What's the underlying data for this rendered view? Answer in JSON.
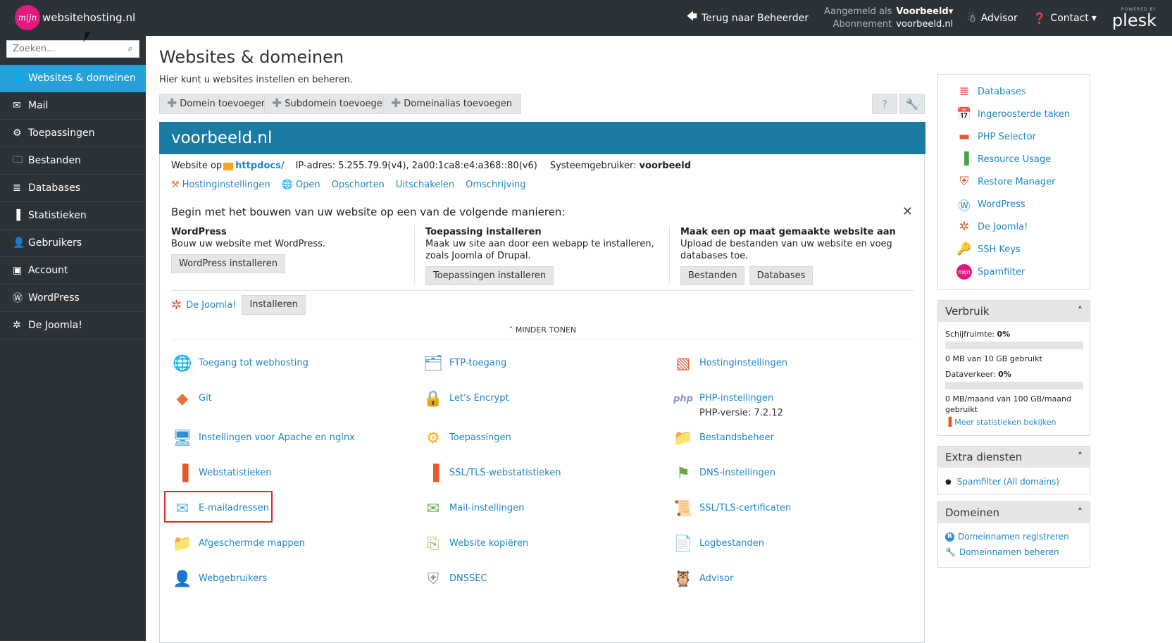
{
  "topbar": {
    "logo_mark": "mijn",
    "logo_text": "websitehosting.nl",
    "back_label": "Terug naar Beheerder",
    "logged_in_label": "Aangemeld als",
    "logged_in_user": "Voorbeeld",
    "subscription_label": "Abonnement",
    "subscription_value": "voorbeeld.nl",
    "advisor_label": "Advisor",
    "contact_label": "Contact",
    "powered_by": "POWERED BY",
    "plesk": "plesk"
  },
  "sidebar": {
    "search_placeholder": "Zoeken...",
    "items": [
      {
        "label": "Websites & domeinen",
        "icon": "globe-icon"
      },
      {
        "label": "Mail",
        "icon": "envelope-icon"
      },
      {
        "label": "Toepassingen",
        "icon": "gear-icon"
      },
      {
        "label": "Bestanden",
        "icon": "folder-icon"
      },
      {
        "label": "Databases",
        "icon": "database-icon"
      },
      {
        "label": "Statistieken",
        "icon": "bar-chart-icon"
      },
      {
        "label": "Gebruikers",
        "icon": "user-icon"
      },
      {
        "label": "Account",
        "icon": "account-icon"
      },
      {
        "label": "WordPress",
        "icon": "wordpress-icon"
      },
      {
        "label": "De Joomla!",
        "icon": "joomla-icon"
      }
    ]
  },
  "main": {
    "title": "Websites & domeinen",
    "subtitle": "Hier kunt u websites instellen en beheren.",
    "toolbar": {
      "add_domain": "Domein toevoegen",
      "add_subdomain": "Subdomein toevoegen",
      "add_alias": "Domeinalias toevoegen"
    },
    "domain": {
      "name": "voorbeeld.nl",
      "website_at_label": "Website op",
      "docroot": "httpdocs/",
      "ip_label": "IP-adres:",
      "ip_value": "5.255.79.9(v4), 2a00:1ca8:e4:a368::80(v6)",
      "sysuser_label": "Systeemgebruiker:",
      "sysuser_value": "voorbeeld",
      "links": {
        "hosting": "Hostinginstellingen",
        "open": "Open",
        "suspend": "Opschorten",
        "disable": "Uitschakelen",
        "description": "Omschrijving"
      }
    },
    "build": {
      "title": "Begin met het bouwen van uw website op een van de volgende manieren:",
      "cols": [
        {
          "title": "WordPress",
          "text": "Bouw uw website met WordPress.",
          "buttons": [
            "WordPress installeren"
          ]
        },
        {
          "title": "Toepassing installeren",
          "text": "Maak uw site aan door een webapp te installeren, zoals Joomla of Drupal.",
          "buttons": [
            "Toepassingen installeren"
          ]
        },
        {
          "title": "Maak een op maat gemaakte website aan",
          "text": "Upload de bestanden van uw website en voeg databases toe.",
          "buttons": [
            "Bestanden",
            "Databases"
          ]
        }
      ]
    },
    "joomla": {
      "label": "De Joomla!",
      "button": "Installeren"
    },
    "less_label": "MINDER TONEN",
    "tools": [
      {
        "label": "Toegang tot webhosting",
        "icon": "web-hosting-access-icon"
      },
      {
        "label": "FTP-toegang",
        "icon": "ftp-icon"
      },
      {
        "label": "Hostinginstellingen",
        "icon": "hosting-settings-icon"
      },
      {
        "label": "Git",
        "icon": "git-icon"
      },
      {
        "label": "Let's Encrypt",
        "icon": "lets-encrypt-icon"
      },
      {
        "label": "PHP-instellingen",
        "icon": "php-icon",
        "sub": "PHP-versie: 7.2.12"
      },
      {
        "label": "Instellingen voor Apache en nginx",
        "icon": "apache-nginx-icon"
      },
      {
        "label": "Toepassingen",
        "icon": "applications-icon"
      },
      {
        "label": "Bestandsbeheer",
        "icon": "file-manager-icon"
      },
      {
        "label": "Webstatistieken",
        "icon": "web-statistics-icon"
      },
      {
        "label": "SSL/TLS-webstatistieken",
        "icon": "ssl-statistics-icon"
      },
      {
        "label": "DNS-instellingen",
        "icon": "dns-icon"
      },
      {
        "label": "E-mailadressen",
        "icon": "email-icon"
      },
      {
        "label": "Mail-instellingen",
        "icon": "mail-settings-icon"
      },
      {
        "label": "SSL/TLS-certificaten",
        "icon": "certificate-icon"
      },
      {
        "label": "Afgeschermde mappen",
        "icon": "protected-folder-icon"
      },
      {
        "label": "Website kopiëren",
        "icon": "copy-website-icon"
      },
      {
        "label": "Logbestanden",
        "icon": "log-files-icon"
      },
      {
        "label": "Webgebruikers",
        "icon": "web-users-icon"
      },
      {
        "label": "DNSSEC",
        "icon": "dnssec-icon"
      },
      {
        "label": "Advisor",
        "icon": "advisor-owl-icon"
      }
    ]
  },
  "right": {
    "quick": [
      {
        "label": "Databases",
        "icon": "database-icon"
      },
      {
        "label": "Ingeroosterde taken",
        "icon": "calendar-icon"
      },
      {
        "label": "PHP Selector",
        "icon": "php-selector-icon"
      },
      {
        "label": "Resource Usage",
        "icon": "resource-usage-icon"
      },
      {
        "label": "Restore Manager",
        "icon": "restore-icon"
      },
      {
        "label": "WordPress",
        "icon": "wordpress-icon"
      },
      {
        "label": "De Joomla!",
        "icon": "joomla-icon"
      },
      {
        "label": "SSH Keys",
        "icon": "ssh-key-icon"
      },
      {
        "label": "Spamfilter",
        "icon": "spamfilter-icon"
      }
    ],
    "usage": {
      "title": "Verbruik",
      "disk_label": "Schijfruimte:",
      "disk_pct": "0%",
      "disk_fraction": 0,
      "disk_text": "0 MB van 10 GB gebruikt",
      "traffic_label": "Dataverkeer:",
      "traffic_pct": "0%",
      "traffic_fraction": 0,
      "traffic_text": "0 MB/maand van 100 GB/maand gebruikt",
      "more_link": "Meer statistieken bekijken"
    },
    "extra": {
      "title": "Extra diensten",
      "items": [
        "Spamfilter (All domains)"
      ]
    },
    "domains": {
      "title": "Domeinen",
      "register": "Domeinnamen registreren",
      "manage": "Domeinnamen beheren"
    }
  }
}
